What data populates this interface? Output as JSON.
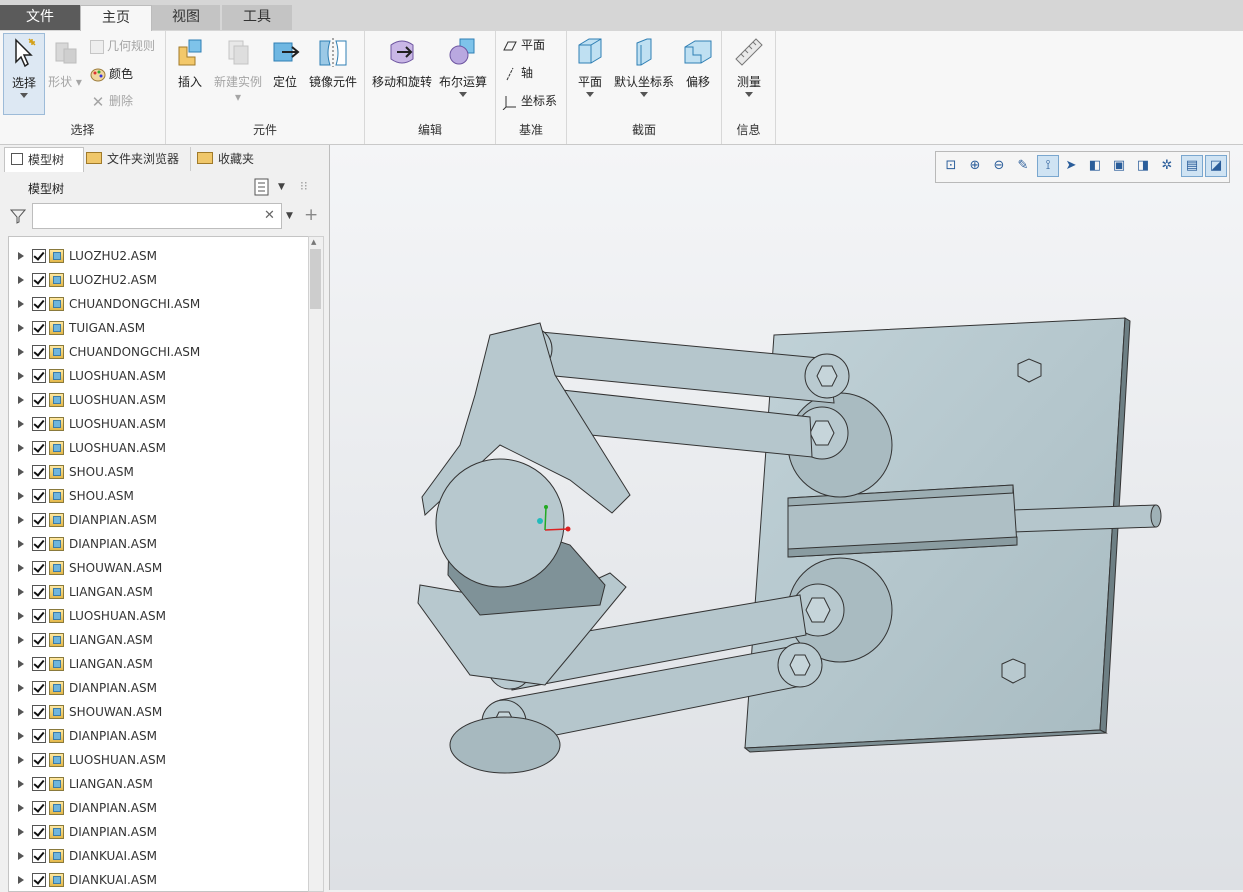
{
  "tabs": {
    "file": "文件",
    "home": "主页",
    "view": "视图",
    "tools": "工具"
  },
  "ribbon": {
    "select_group": {
      "label": "选择",
      "select": "选择",
      "shape": "形状",
      "geom_rule": "几何规则",
      "color": "颜色",
      "delete": "删除"
    },
    "component_group": {
      "label": "元件",
      "insert": "插入",
      "new_instance": "新建实例",
      "locate": "定位",
      "mirror": "镜像元件"
    },
    "edit_group": {
      "label": "编辑",
      "move_rotate": "移动和旋转",
      "boolean": "布尔运算"
    },
    "datum_group": {
      "label": "基准",
      "plane": "平面",
      "axis": "轴",
      "csys": "坐标系"
    },
    "section_group": {
      "label": "截面",
      "plane": "平面",
      "default_csys": "默认坐标系",
      "offset": "偏移"
    },
    "info_group": {
      "label": "信息",
      "measure": "测量"
    }
  },
  "left_panel": {
    "tabs": [
      "模型树",
      "文件夹浏览器",
      "收藏夹"
    ],
    "tree_header": "模型树",
    "filter_placeholder": "",
    "tree_items": [
      "LUOZHU2.ASM",
      "LUOZHU2.ASM",
      "CHUANDONGCHI.ASM",
      "TUIGAN.ASM",
      "CHUANDONGCHI.ASM",
      "LUOSHUAN.ASM",
      "LUOSHUAN.ASM",
      "LUOSHUAN.ASM",
      "LUOSHUAN.ASM",
      "SHOU.ASM",
      "SHOU.ASM",
      "DIANPIAN.ASM",
      "DIANPIAN.ASM",
      "SHOUWAN.ASM",
      "LIANGAN.ASM",
      "LUOSHUAN.ASM",
      "LIANGAN.ASM",
      "LIANGAN.ASM",
      "DIANPIAN.ASM",
      "SHOUWAN.ASM",
      "DIANPIAN.ASM",
      "LUOSHUAN.ASM",
      "LIANGAN.ASM",
      "DIANPIAN.ASM",
      "DIANPIAN.ASM",
      "DIANKUAI.ASM",
      "DIANKUAI.ASM"
    ]
  },
  "view_toolbar": [
    "refit-icon",
    "zoom-in-icon",
    "zoom-out-icon",
    "repaint-icon",
    "spin-center-icon",
    "view-manager-icon",
    "saved-views-icon",
    "display-style-icon",
    "perspective-icon",
    "datum-display-icon",
    "annotation-display-icon",
    "appearance-icon"
  ],
  "colors": {
    "model_fill": "#b5c7cd",
    "model_dark": "#7f9298",
    "accent": "#2a5d9a"
  }
}
